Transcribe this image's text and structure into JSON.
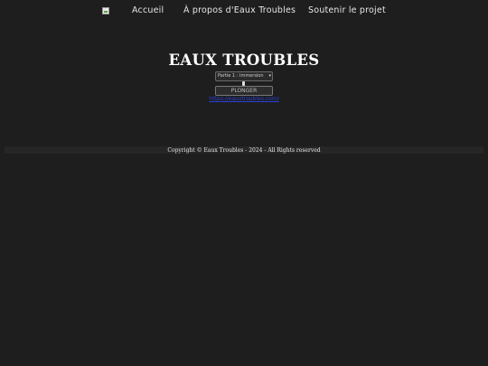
{
  "nav": {
    "logo_alt": "",
    "links": [
      {
        "label": "Accueil"
      },
      {
        "label": "À propos d'Eaux Troubles"
      },
      {
        "label": "Soutenir le projet"
      }
    ]
  },
  "main": {
    "title": "EAUX TROUBLES",
    "part_select": {
      "selected": "Partie 1 : Immersion"
    },
    "dive_button": "PLONGER",
    "link_text": "https://eauxtroubles.com/"
  },
  "footer": {
    "text": "Copyright © Eaux Troubles - 2024 - All Rights reserved"
  },
  "colors": {
    "background": "#1e1e1e",
    "footer_bar": "#262626",
    "link_blue": "#2a3fd8",
    "text": "#ffffff"
  }
}
